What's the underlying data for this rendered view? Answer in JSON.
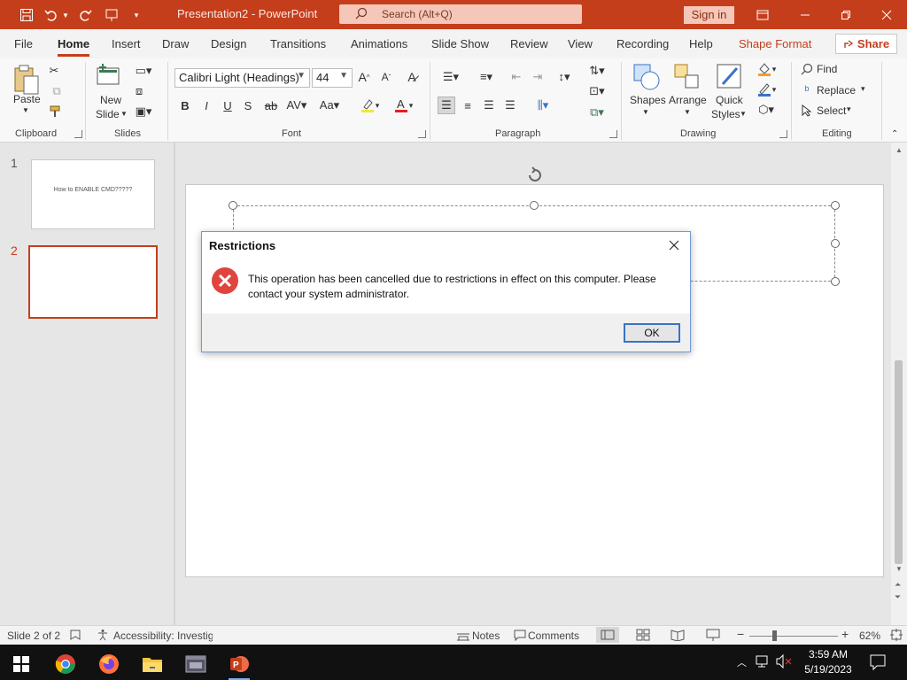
{
  "app": {
    "doc_title": "Presentation2  -  PowerPoint",
    "search_placeholder": "Search (Alt+Q)",
    "sign_in": "Sign in"
  },
  "menu": {
    "tabs": [
      "File",
      "Home",
      "Insert",
      "Draw",
      "Design",
      "Transitions",
      "Animations",
      "Slide Show",
      "Review",
      "View",
      "Recording",
      "Help",
      "Shape Format"
    ],
    "share": "Share"
  },
  "ribbon": {
    "clipboard": {
      "paste": "Paste",
      "group": "Clipboard"
    },
    "slides": {
      "new_slide_1": "New",
      "new_slide_2": "Slide",
      "group": "Slides"
    },
    "font": {
      "name": "Calibri Light (Headings)",
      "size": "44",
      "group": "Font"
    },
    "paragraph": {
      "group": "Paragraph"
    },
    "drawing": {
      "shapes": "Shapes",
      "arrange": "Arrange",
      "quick_styles_1": "Quick",
      "quick_styles_2": "Styles",
      "group": "Drawing"
    },
    "editing": {
      "find": "Find",
      "replace": "Replace",
      "select": "Select",
      "group": "Editing"
    }
  },
  "thumbnails": [
    {
      "num": "1",
      "text": "How to ENABLE CMD?????"
    },
    {
      "num": "2",
      "text": ""
    }
  ],
  "dialog": {
    "title": "Restrictions",
    "message": "This operation has been cancelled due to restrictions in effect on this computer. Please contact your system administrator.",
    "ok": "OK"
  },
  "status": {
    "slide_info": "Slide 2 of 2",
    "accessibility": "Accessibility: Investigate",
    "notes": "Notes",
    "comments": "Comments",
    "zoom": "62%"
  },
  "taskbar": {
    "time": "3:59 AM",
    "date": "5/19/2023"
  },
  "colors": {
    "accent": "#c43e1c",
    "error": "#e0443e"
  }
}
